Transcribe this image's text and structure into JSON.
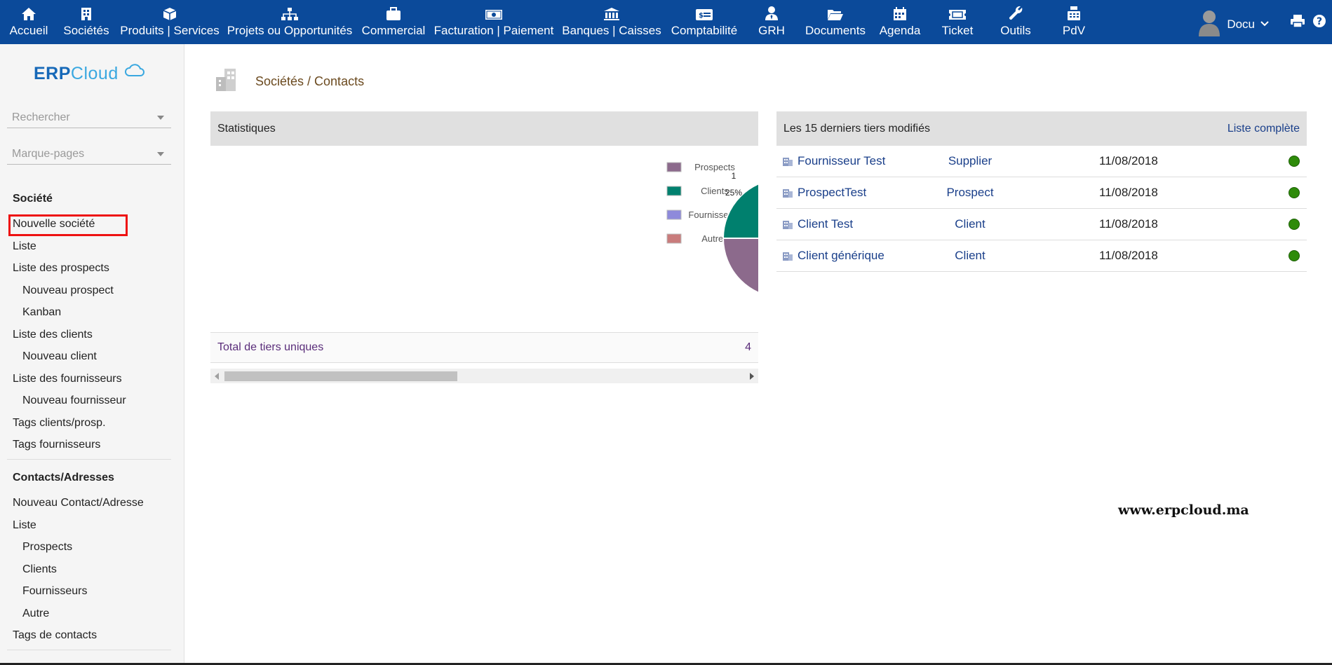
{
  "nav": {
    "items": [
      {
        "label": "Accueil",
        "icon": "home-icon"
      },
      {
        "label": "Sociétés",
        "icon": "building-icon"
      },
      {
        "label": "Produits | Services",
        "icon": "cube-icon"
      },
      {
        "label": "Projets ou Opportunités",
        "icon": "sitemap-icon"
      },
      {
        "label": "Commercial",
        "icon": "briefcase-icon"
      },
      {
        "label": "Facturation | Paiement",
        "icon": "money-bill-icon"
      },
      {
        "label": "Banques | Caisses",
        "icon": "bank-icon"
      },
      {
        "label": "Comptabilité",
        "icon": "ledger-icon"
      },
      {
        "label": "GRH",
        "icon": "user-tie-icon"
      },
      {
        "label": "Documents",
        "icon": "folder-open-icon"
      },
      {
        "label": "Agenda",
        "icon": "calendar-icon"
      },
      {
        "label": "Ticket",
        "icon": "ticket-icon"
      },
      {
        "label": "Outils",
        "icon": "wrench-icon"
      },
      {
        "label": "PdV",
        "icon": "cash-register-icon"
      }
    ],
    "active": "Sociétés",
    "user": "Docu"
  },
  "sidebar": {
    "logo_erp": "ERP",
    "logo_cloud": "Cloud",
    "search_placeholder": "Rechercher",
    "bookmarks_placeholder": "Marque-pages",
    "section1_title": "Société",
    "section1_links": [
      "Nouvelle société",
      "Liste",
      "Liste des prospects",
      "Nouveau prospect",
      "Kanban",
      "Liste des clients",
      "Nouveau client",
      "Liste des fournisseurs",
      "Nouveau fournisseur",
      "Tags clients/prosp.",
      "Tags fournisseurs"
    ],
    "section2_title": "Contacts/Adresses",
    "section2_links": [
      "Nouveau Contact/Adresse",
      "Liste",
      "Prospects",
      "Clients",
      "Fournisseurs",
      "Autre",
      "Tags de contacts"
    ]
  },
  "main": {
    "page_title": "Sociétés / Contacts",
    "stats": {
      "title": "Statistiques",
      "total_label": "Total de tiers uniques",
      "total_value": "4"
    },
    "recent": {
      "title": "Les 15 derniers tiers modifiés",
      "full_list": "Liste complète",
      "rows": [
        {
          "name": "Fournisseur Test",
          "type": "Supplier",
          "date": "11/08/2018"
        },
        {
          "name": "ProspectTest",
          "type": "Prospect",
          "date": "11/08/2018"
        },
        {
          "name": "Client Test",
          "type": "Client",
          "date": "11/08/2018"
        },
        {
          "name": "Client générique",
          "type": "Client",
          "date": "11/08/2018"
        }
      ]
    },
    "watermark": "www.erpcloud.ma"
  },
  "chart_data": {
    "type": "pie",
    "categories": [
      "Prospects",
      "Clients",
      "Fournisseurs",
      "Autres"
    ],
    "values": [
      1,
      1,
      1,
      1
    ],
    "colors": [
      "#8c6a8c",
      "#00806e",
      "#8e8adb",
      "#c97c7c"
    ],
    "labels": [
      "1",
      "25%"
    ],
    "legend": "left"
  }
}
